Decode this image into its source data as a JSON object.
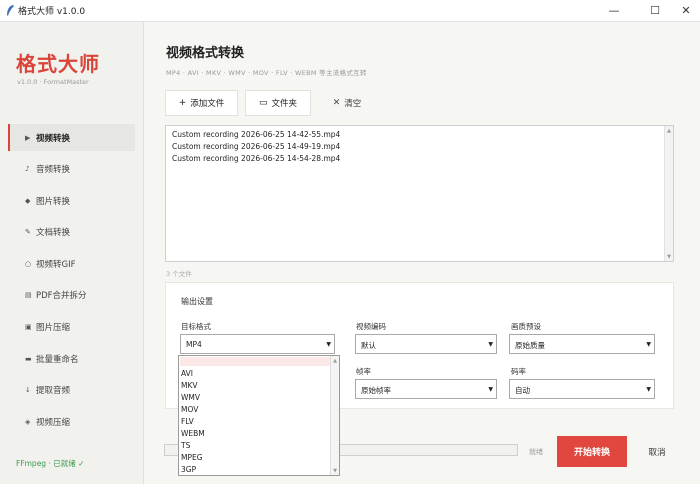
{
  "window": {
    "title": "格式大师 v1.0.0",
    "minimize": "—",
    "maximize": "☐",
    "close": "✕"
  },
  "sidebar": {
    "brand": "格式大师",
    "version": "v1.0.0 · FormatMaster",
    "items": [
      {
        "icon": "▶",
        "label": "视频转换",
        "active": true
      },
      {
        "icon": "♪",
        "label": "音频转换"
      },
      {
        "icon": "◆",
        "label": "图片转换"
      },
      {
        "icon": "✎",
        "label": "文档转换"
      },
      {
        "icon": "○",
        "label": "视频转GIF"
      },
      {
        "icon": "▤",
        "label": "PDF合并拆分"
      },
      {
        "icon": "▣",
        "label": "图片压缩"
      },
      {
        "icon": "▬",
        "label": "批量重命名"
      },
      {
        "icon": "↓",
        "label": "提取音频"
      },
      {
        "icon": "◈",
        "label": "视频压缩"
      }
    ],
    "status": "FFmpeg · 已就绪 ✓"
  },
  "main": {
    "title": "视频格式转换",
    "subtitle": "MP4 · AVI · MKV · WMV · MOV · FLV · WEBM 等主流格式互转",
    "toolbar": {
      "add_icon": "+",
      "add_label": "添加文件",
      "folder_icon": "▭",
      "folder_label": "文件夹",
      "clear_icon": "✕",
      "clear_label": "清空"
    },
    "files": [
      "Custom recording 2026-06-25 14-42-55.mp4",
      "Custom recording 2026-06-25 14-49-19.mp4",
      "Custom recording 2026-06-25 14-54-28.mp4"
    ],
    "file_count": "3 个文件",
    "settings": {
      "title": "输出设置",
      "target_format_label": "目标格式",
      "target_format_value": "MP4",
      "video_codec_label": "视频编码",
      "video_codec_value": "默认",
      "quality_label": "画质预设",
      "quality_value": "原始质量",
      "fps_label": "帧率",
      "fps_value": "原始帧率",
      "bitrate_label": "码率",
      "bitrate_value": "自动"
    },
    "format_options": [
      "AVI",
      "MKV",
      "WMV",
      "MOV",
      "FLV",
      "WEBM",
      "TS",
      "MPEG",
      "3GP"
    ],
    "ready_text": "就绪",
    "start_label": "开始转换",
    "cancel_label": "取消"
  },
  "colors": {
    "accent": "#e1473e",
    "brand": "#d9453a",
    "status_ok": "#3a9b4b"
  }
}
